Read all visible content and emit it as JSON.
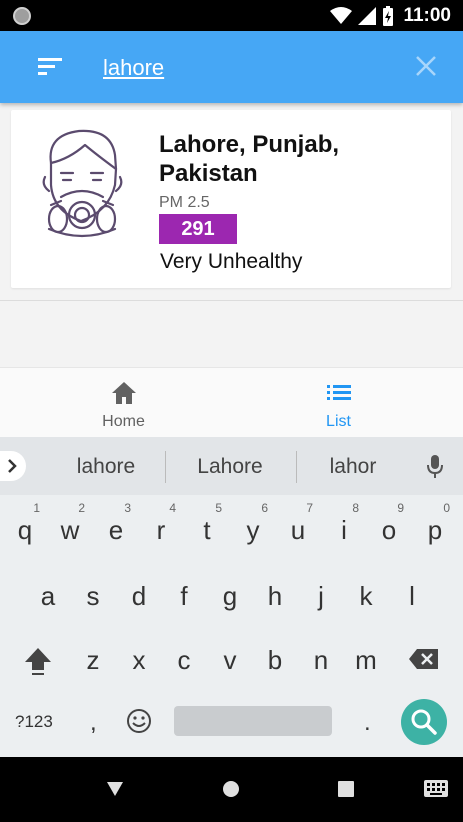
{
  "status_bar": {
    "time": "11:00"
  },
  "search": {
    "query": "lahore"
  },
  "result": {
    "location": "Lahore, Punjab, Pakistan",
    "pollutant": "PM 2.5",
    "aqi": "291",
    "category": "Very Unhealthy",
    "aqi_color": "#9c27b0"
  },
  "bottom_nav": {
    "items": [
      {
        "label": "Home",
        "icon": "home-icon",
        "active": false
      },
      {
        "label": "List",
        "icon": "list-icon",
        "active": true
      }
    ],
    "active_color": "#2196f3",
    "inactive_color": "#616161"
  },
  "keyboard": {
    "suggestions": [
      "lahore",
      "Lahore",
      "lahor"
    ],
    "row1": [
      {
        "k": "q",
        "h": "1"
      },
      {
        "k": "w",
        "h": "2"
      },
      {
        "k": "e",
        "h": "3"
      },
      {
        "k": "r",
        "h": "4"
      },
      {
        "k": "t",
        "h": "5"
      },
      {
        "k": "y",
        "h": "6"
      },
      {
        "k": "u",
        "h": "7"
      },
      {
        "k": "i",
        "h": "8"
      },
      {
        "k": "o",
        "h": "9"
      },
      {
        "k": "p",
        "h": "0"
      }
    ],
    "row2": [
      "a",
      "s",
      "d",
      "f",
      "g",
      "h",
      "j",
      "k",
      "l"
    ],
    "row3": [
      "z",
      "x",
      "c",
      "v",
      "b",
      "n",
      "m"
    ],
    "symbols_key": "?123",
    "comma_key": ",",
    "period_key": "."
  },
  "colors": {
    "app_bar": "#46a7f5",
    "search_key": "#3db2a5"
  }
}
